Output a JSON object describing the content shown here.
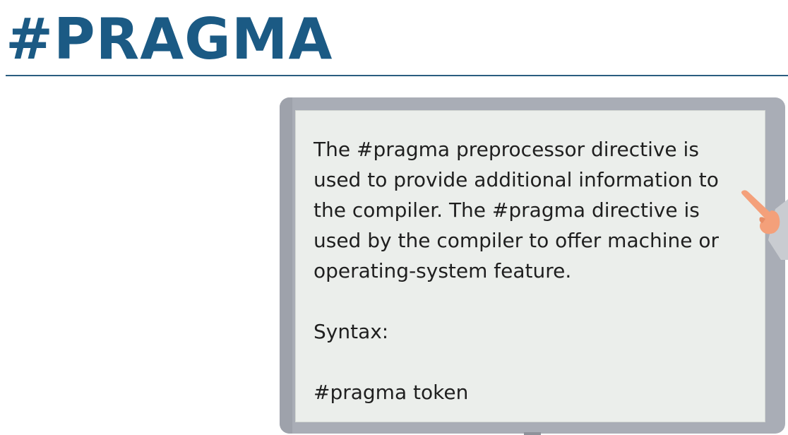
{
  "slide": {
    "title": "#PRAGMA",
    "board": {
      "paragraph": "The #pragma preprocessor directive is used to provide additional information to the compiler. The #pragma directive is used by the compiler to offer machine or operating-system feature.",
      "paragraph_lines": [
        "The #pragma preprocessor directive is",
        "used to provide additional information to",
        "the compiler. The #pragma directive is",
        "used by the compiler to offer machine or",
        "operating-system feature."
      ],
      "syntax_label": "Syntax:",
      "syntax_example": "#pragma token"
    }
  },
  "colors": {
    "title": "#1b5a84",
    "rule": "#2a5d80",
    "board_frame": "#a9adb6",
    "board_surface": "#ebeeeb",
    "hand_skin": "#f4a07a",
    "sleeve": "#c9ccd1"
  },
  "icons": [
    "pointing-hand-icon"
  ]
}
